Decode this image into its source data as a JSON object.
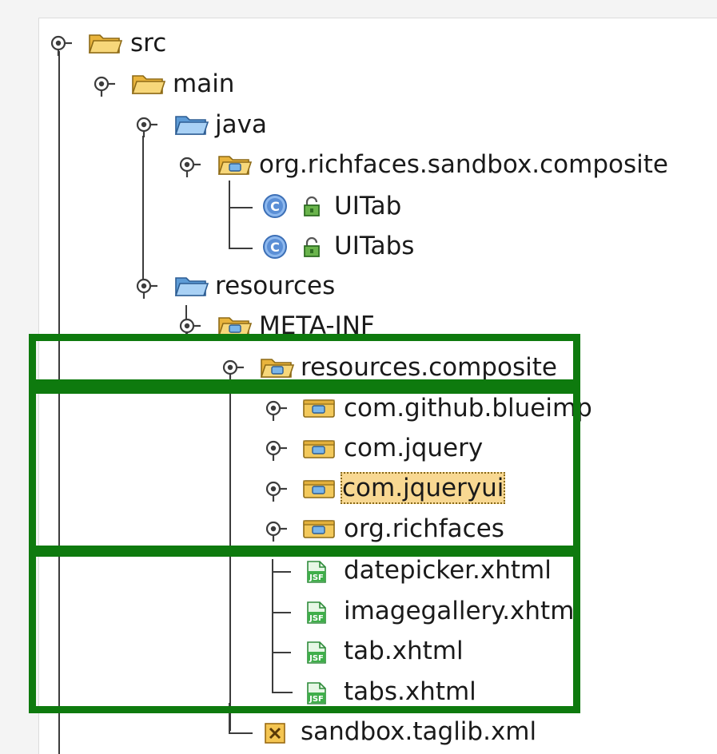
{
  "tree": {
    "src": "src",
    "main": "main",
    "java": "java",
    "package": "org.richfaces.sandbox.composite",
    "class_uitab": "UITab",
    "class_uitabs": "UITabs",
    "resources": "resources",
    "meta_inf": "META-INF",
    "resources_composite": "resources.composite",
    "com_github_blueimp": "com.github.blueimp",
    "com_jquery": "com.jquery",
    "com_jqueryui": "com.jqueryui",
    "org_richfaces": "org.richfaces",
    "datepicker": "datepicker.xhtml",
    "imagegallery": "imagegallery.xhtml",
    "tab": "tab.xhtml",
    "tabs": "tabs.xhtml",
    "taglib": "sandbox.taglib.xml"
  },
  "selected": "com.jqueryui",
  "colors": {
    "highlight_box": "#0e7a0e",
    "selection": "#f8d892",
    "tree_line": "#3c3c3c",
    "folder": "#f3c95c",
    "source_folder": "#7fb6e6",
    "class_icon": "#5b8fd6",
    "jsf_icon": "#3fae4a"
  },
  "icons": [
    "expander-icon",
    "folder-icon",
    "source-folder-icon",
    "package-folder-icon",
    "class-icon",
    "lock-icon",
    "jsf-file-icon",
    "xml-file-icon"
  ]
}
